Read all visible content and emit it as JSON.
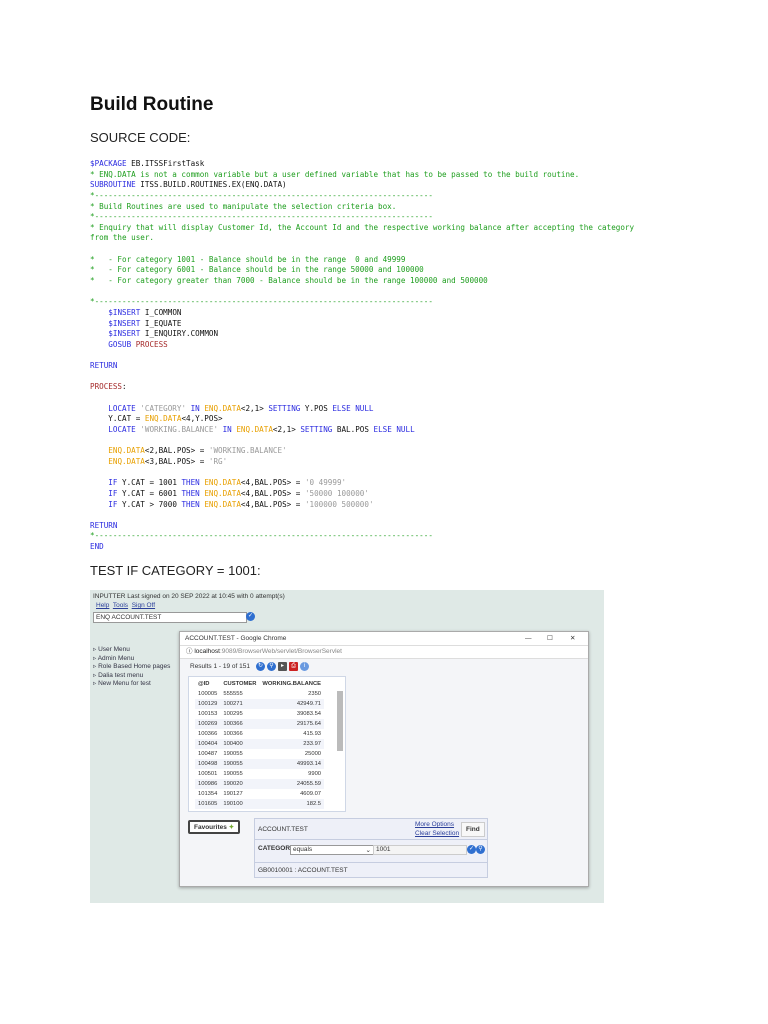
{
  "title": "Build Routine",
  "source_heading": "SOURCE CODE:",
  "code": [
    [
      [
        "k",
        "$PACKAGE"
      ],
      [
        "t",
        " EB.ITSSFirstTask"
      ]
    ],
    [
      [
        "c",
        "* ENQ.DATA is not a common variable but a user defined variable that has to be passed to the build routine."
      ]
    ],
    [
      [
        "k",
        "SUBROUTINE"
      ],
      [
        "t",
        " ITSS.BUILD.ROUTINES.EX(ENQ.DATA)"
      ]
    ],
    [
      [
        "c",
        "*--------------------------------------------------------------------------"
      ]
    ],
    [
      [
        "c",
        "* Build Routines are used to manipulate the selection criteria box."
      ]
    ],
    [
      [
        "c",
        "*--------------------------------------------------------------------------"
      ]
    ],
    [
      [
        "c",
        "* Enquiry that will display Customer Id, the Account Id and the respective working balance after accepting the category"
      ]
    ],
    [
      [
        "c",
        "from the user."
      ]
    ],
    [],
    [
      [
        "c",
        "*   - For category 1001 - Balance should be in the range  0 and 49999"
      ]
    ],
    [
      [
        "c",
        "*   - For category 6001 - Balance should be in the range 50000 and 100000"
      ]
    ],
    [
      [
        "c",
        "*   - For category greater than 7000 - Balance should be in the range 100000 and 500000"
      ]
    ],
    [],
    [
      [
        "c",
        "*--------------------------------------------------------------------------"
      ]
    ],
    [
      [
        "t",
        "    "
      ],
      [
        "k",
        "$INSERT"
      ],
      [
        "t",
        " I_COMMON"
      ]
    ],
    [
      [
        "t",
        "    "
      ],
      [
        "k",
        "$INSERT"
      ],
      [
        "t",
        " I_EQUATE"
      ]
    ],
    [
      [
        "t",
        "    "
      ],
      [
        "k",
        "$INSERT"
      ],
      [
        "t",
        " I_ENQUIRY.COMMON"
      ]
    ],
    [
      [
        "t",
        "    "
      ],
      [
        "k",
        "GOSUB"
      ],
      [
        "l",
        " PROCESS"
      ]
    ],
    [],
    [
      [
        "k",
        "RETURN"
      ]
    ],
    [],
    [
      [
        "l",
        "PROCESS"
      ],
      [
        "t",
        ":"
      ]
    ],
    [],
    [
      [
        "t",
        "    "
      ],
      [
        "k",
        "LOCATE"
      ],
      [
        "s",
        " 'CATEGORY'"
      ],
      [
        "k",
        " IN"
      ],
      [
        "o",
        " ENQ.DATA"
      ],
      [
        "t",
        "<2,1>"
      ],
      [
        "k",
        " SETTING"
      ],
      [
        "t",
        " Y.POS"
      ],
      [
        "k",
        " ELSE NULL"
      ]
    ],
    [
      [
        "t",
        "    Y.CAT = "
      ],
      [
        "o",
        "ENQ.DATA"
      ],
      [
        "t",
        "<4,Y.POS>"
      ]
    ],
    [
      [
        "t",
        "    "
      ],
      [
        "k",
        "LOCATE"
      ],
      [
        "s",
        " 'WORKING.BALANCE'"
      ],
      [
        "k",
        " IN"
      ],
      [
        "o",
        " ENQ.DATA"
      ],
      [
        "t",
        "<2,1>"
      ],
      [
        "k",
        " SETTING"
      ],
      [
        "t",
        " BAL.POS"
      ],
      [
        "k",
        " ELSE NULL"
      ]
    ],
    [],
    [
      [
        "t",
        "    "
      ],
      [
        "o",
        "ENQ.DATA"
      ],
      [
        "t",
        "<2,BAL.POS> = "
      ],
      [
        "s",
        "'WORKING.BALANCE'"
      ]
    ],
    [
      [
        "t",
        "    "
      ],
      [
        "o",
        "ENQ.DATA"
      ],
      [
        "t",
        "<3,BAL.POS> = "
      ],
      [
        "s",
        "'RG'"
      ]
    ],
    [],
    [
      [
        "t",
        "    "
      ],
      [
        "k",
        "IF"
      ],
      [
        "t",
        " Y.CAT = 1001 "
      ],
      [
        "k",
        "THEN"
      ],
      [
        "o",
        " ENQ.DATA"
      ],
      [
        "t",
        "<4,BAL.POS> = "
      ],
      [
        "s",
        "'0 49999'"
      ]
    ],
    [
      [
        "t",
        "    "
      ],
      [
        "k",
        "IF"
      ],
      [
        "t",
        " Y.CAT = 6001 "
      ],
      [
        "k",
        "THEN"
      ],
      [
        "o",
        " ENQ.DATA"
      ],
      [
        "t",
        "<4,BAL.POS> = "
      ],
      [
        "s",
        "'50000 100000'"
      ]
    ],
    [
      [
        "t",
        "    "
      ],
      [
        "k",
        "IF"
      ],
      [
        "t",
        " Y.CAT > 7000 "
      ],
      [
        "k",
        "THEN"
      ],
      [
        "o",
        " ENQ.DATA"
      ],
      [
        "t",
        "<4,BAL.POS> = "
      ],
      [
        "s",
        "'100000 500000'"
      ]
    ],
    [],
    [
      [
        "k",
        "RETURN"
      ]
    ],
    [
      [
        "c",
        "*--------------------------------------------------------------------------"
      ]
    ],
    [
      [
        "k",
        "END"
      ]
    ]
  ],
  "test_heading": "TEST IF CATEGORY = 1001:",
  "screenshot": {
    "signon": "INPUTTER Last signed on 20 SEP 2022 at 10:45 with 0 attempt(s)",
    "links": [
      "Help",
      "Tools",
      "Sign Off"
    ],
    "command_value": "ENQ ACCOUNT.TEST",
    "menu": [
      "User Menu",
      "Admin Menu",
      "Role Based Home pages",
      "Dalia test menu",
      "New Menu for test"
    ],
    "window_title": "ACCOUNT.TEST - Google Chrome",
    "url_host": "localhost",
    "url_rest": ":9089/BrowserWeb/servlet/BrowserServlet",
    "results": "Results 1 - 19 of 151",
    "columns": [
      "@ID",
      "CUSTOMER",
      "WORKING.BALANCE"
    ],
    "rows": [
      [
        "100005",
        "555555",
        "2350"
      ],
      [
        "100129",
        "100271",
        "42949.71"
      ],
      [
        "100153",
        "100295",
        "39083.54"
      ],
      [
        "100269",
        "100366",
        "29175.64"
      ],
      [
        "100366",
        "100366",
        "415.93"
      ],
      [
        "100404",
        "100400",
        "233.97"
      ],
      [
        "100487",
        "190055",
        "25000"
      ],
      [
        "100498",
        "190055",
        "49993.14"
      ],
      [
        "100501",
        "190055",
        "9900"
      ],
      [
        "100986",
        "190020",
        "24055.59"
      ],
      [
        "101354",
        "190127",
        "4609.07"
      ],
      [
        "101605",
        "190100",
        "182.5"
      ]
    ],
    "favourites": "Favourites",
    "enquiry_name": "ACCOUNT.TEST",
    "more_options": "More Options",
    "clear_selection": "Clear Selection",
    "find": "Find",
    "field": "CATEGORY",
    "operator": "equals",
    "value": "1001",
    "footer": "GB0010001 : ACCOUNT.TEST"
  }
}
